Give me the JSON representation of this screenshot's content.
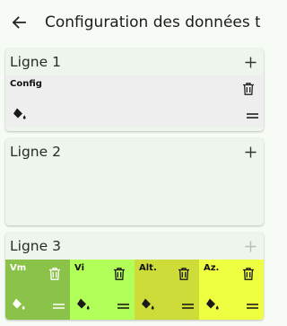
{
  "appbar": {
    "back_icon": "arrow-left-icon",
    "title": "Configuration des données te..."
  },
  "lines": [
    {
      "title": "Ligne 1",
      "add_icon": "plus-icon",
      "tiles": [
        {
          "label": "Config",
          "background": "#eeeeee",
          "label_color": "#111111"
        }
      ]
    },
    {
      "title": "Ligne 2",
      "add_icon": "plus-icon",
      "tiles": []
    },
    {
      "title": "Ligne 3",
      "add_icon": "plus-icon",
      "add_disabled": true,
      "tiles": [
        {
          "label": "Vm",
          "background": "#8bc34a",
          "label_color": "#ffffff"
        },
        {
          "label": "Vi",
          "background": "#b2ff59",
          "label_color": "#111111"
        },
        {
          "label": "Alt.",
          "background": "#cddc39",
          "label_color": "#111111"
        },
        {
          "label": "Az.",
          "background": "#eeff41",
          "label_color": "#111111"
        }
      ]
    }
  ],
  "tile_icons": {
    "delete": "trash-icon",
    "color": "paint-bucket-icon",
    "reorder": "drag-handle-icon"
  }
}
